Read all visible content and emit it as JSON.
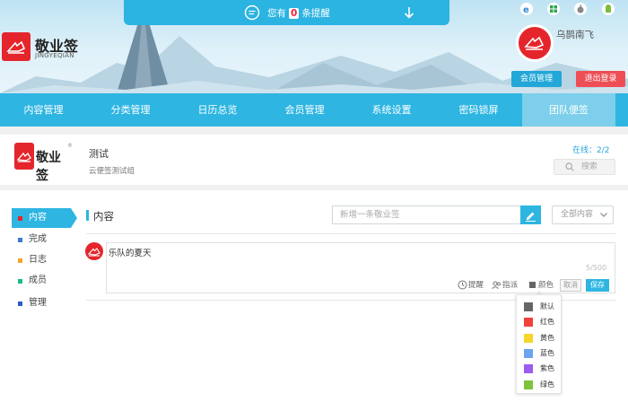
{
  "notice": {
    "prefix": "您有",
    "count": "0",
    "suffix": "条提醒"
  },
  "brand": {
    "title": "敬业签",
    "sub": "JINGYEQIAN"
  },
  "user": {
    "name": "乌鹊南飞"
  },
  "header_buttons": {
    "member": "会员管理",
    "logout": "退出登录"
  },
  "nav": {
    "items": [
      "内容管理",
      "分类管理",
      "日历总览",
      "会员管理",
      "系统设置",
      "密码锁屏",
      "团队便签"
    ],
    "active_index": 6
  },
  "group": {
    "name": "测试",
    "desc": "云便签测试组",
    "online": "在线：2/2",
    "search_placeholder": "搜索",
    "logo_title": "敬业签",
    "reg_mark": "®"
  },
  "sidebar": {
    "items": [
      {
        "label": "内容",
        "color": "#e4262c",
        "active": true
      },
      {
        "label": "完成",
        "color": "#3a7bd5",
        "active": false
      },
      {
        "label": "日志",
        "color": "#f5a623",
        "active": false
      },
      {
        "label": "成员",
        "color": "#1bb98a",
        "active": false
      },
      {
        "label": "管理",
        "color": "#2a5bd0",
        "active": false
      }
    ]
  },
  "content": {
    "section_title": "内容",
    "new_placeholder": "新增一条敬业签",
    "filter_label": "全部内容",
    "post_text": "乐队的夏天",
    "char_count": "5/500",
    "toolbar": {
      "remind": "提醒",
      "assign": "指派",
      "color": "颜色",
      "cancel": "取消",
      "save": "保存"
    }
  },
  "colors": [
    {
      "label": "默认",
      "hex": "#666666"
    },
    {
      "label": "红色",
      "hex": "#f2413a"
    },
    {
      "label": "黄色",
      "hex": "#f7d52b"
    },
    {
      "label": "蓝色",
      "hex": "#6aa3ee"
    },
    {
      "label": "紫色",
      "hex": "#9b5cf0"
    },
    {
      "label": "绿色",
      "hex": "#7cc43a"
    }
  ],
  "accent": "#2eb5e2"
}
